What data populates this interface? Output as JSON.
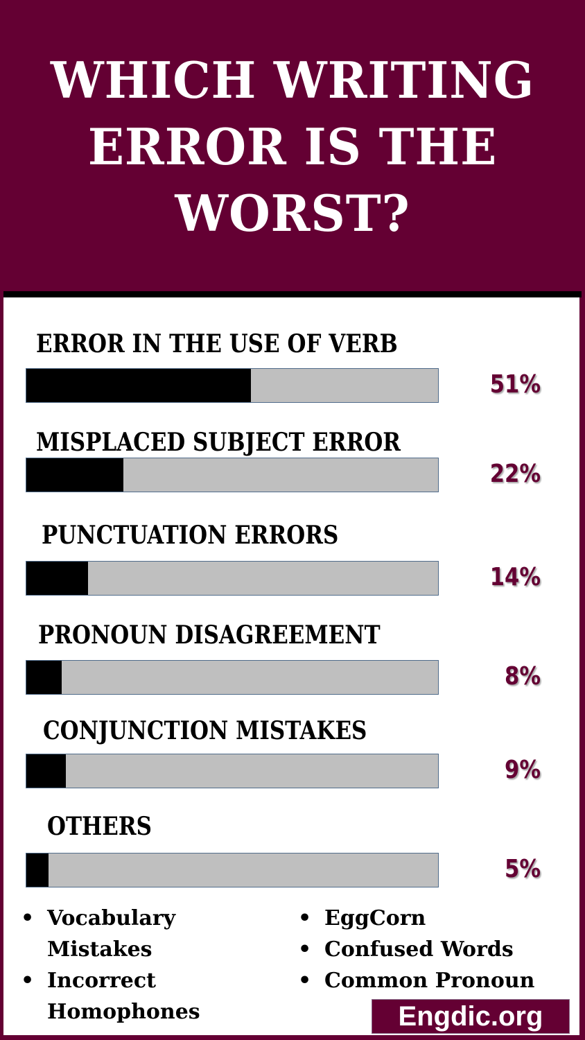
{
  "title": {
    "lines": [
      "WHICH WRITING",
      "ERROR IS THE",
      "WORST?"
    ]
  },
  "colors": {
    "brand": "#640033",
    "bar_fill": "#000000",
    "bar_track": "#bfbfbf",
    "percent_text": "#640033"
  },
  "chart_data": {
    "type": "bar",
    "orientation": "horizontal",
    "title": "WHICH WRITING ERROR IS THE WORST?",
    "categories": [
      "ERROR IN THE USE OF VERB",
      "MISPLACED SUBJECT ERROR",
      "PUNCTUATION ERRORS",
      "PRONOUN DISAGREEMENT",
      "CONJUNCTION MISTAKES",
      "OTHERS"
    ],
    "values": [
      51,
      22,
      14,
      8,
      9,
      5
    ],
    "value_labels": [
      "51%",
      "22%",
      "14%",
      "8%",
      "9%",
      "5%"
    ],
    "unit": "%",
    "xlim": [
      0,
      100
    ],
    "grid": false,
    "legend": "none"
  },
  "others_list": {
    "left": [
      "Vocabulary Mistakes",
      "Incorrect Homophones"
    ],
    "right": [
      "EggCorn",
      "Confused Words",
      "Common Pronoun"
    ],
    "bullet": "•"
  },
  "brand": {
    "label": "Engdic.org"
  }
}
